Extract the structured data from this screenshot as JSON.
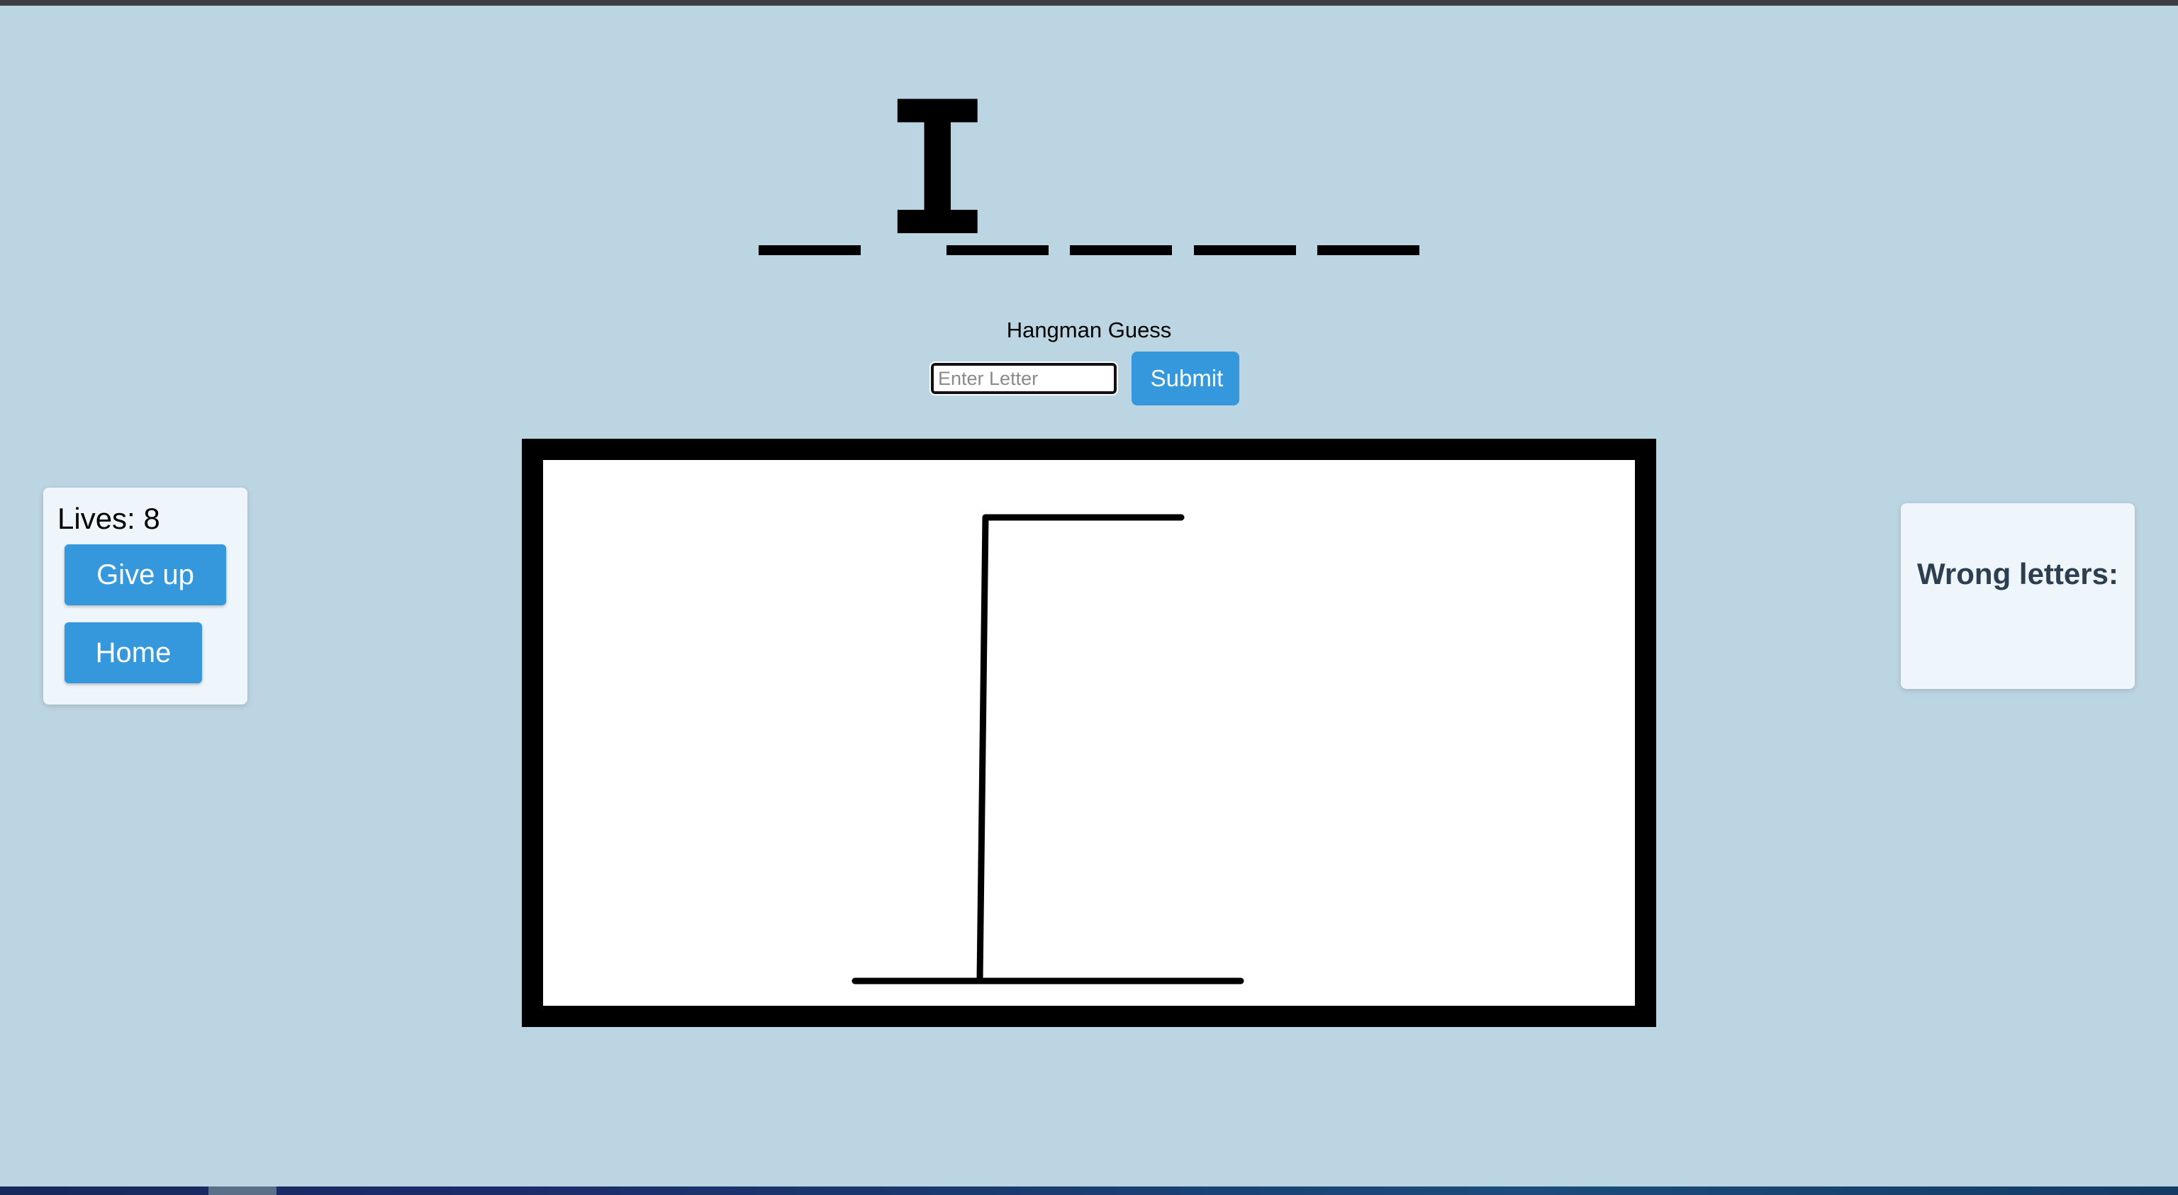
{
  "game": {
    "word_slots": [
      "",
      "I",
      "",
      "",
      "",
      ""
    ],
    "guess_label": "Hangman Guess",
    "guess_placeholder": "Enter Letter",
    "submit_label": "Submit",
    "lives_text": "Lives: 8",
    "lives": 8,
    "give_up_label": "Give up",
    "home_label": "Home",
    "wrong_letters_title": "Wrong letters:",
    "wrong_letters": []
  },
  "drawing": {
    "parts_shown": [
      "base",
      "pole",
      "beam"
    ]
  },
  "colors": {
    "background": "#bcd5e2",
    "button": "#3598dc",
    "panel": "#eff6fb",
    "wrong_title": "#2c3e50"
  }
}
